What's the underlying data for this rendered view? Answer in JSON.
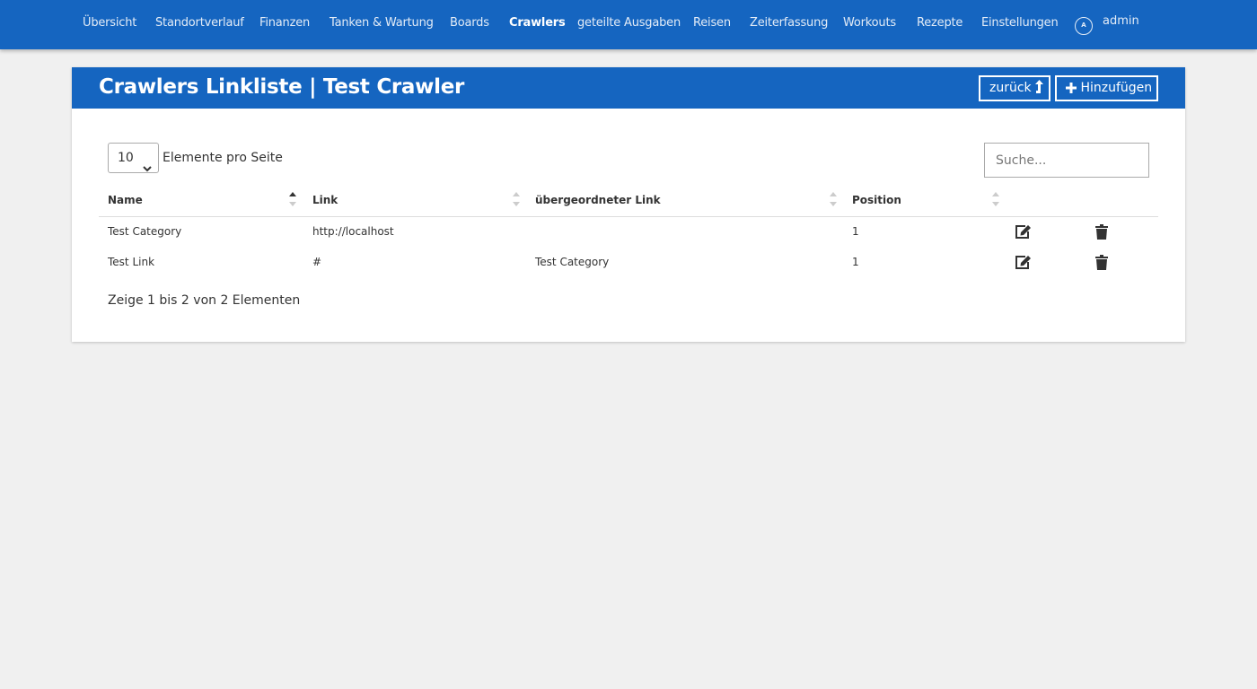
{
  "nav": {
    "items": [
      {
        "label": "Übersicht"
      },
      {
        "label": "Standortverlauf"
      },
      {
        "label": "Finanzen"
      },
      {
        "label": "Tanken & Wartung"
      },
      {
        "label": "Boards"
      },
      {
        "label": "Crawlers"
      },
      {
        "label": "geteilte Ausgaben"
      },
      {
        "label": "Reisen"
      },
      {
        "label": "Zeiterfassung"
      },
      {
        "label": "Workouts"
      },
      {
        "label": "Rezepte"
      },
      {
        "label": "Einstellungen"
      }
    ],
    "active": "Crawlers",
    "user": {
      "initial": "A",
      "name": "admin"
    }
  },
  "page": {
    "title": "Crawlers Linkliste | Test Crawler",
    "back_label": "zurück",
    "add_label": "Hinzufügen"
  },
  "table": {
    "length_value": "10",
    "length_label": "Elemente pro Seite",
    "search_placeholder": "Suche...",
    "columns": [
      "Name",
      "Link",
      "übergeordneter Link",
      "Position"
    ],
    "sorted_column": "Name",
    "rows": [
      {
        "name": "Test Category",
        "link": "http://localhost",
        "parent": "",
        "position": "1"
      },
      {
        "name": "Test Link",
        "link": "#",
        "parent": "Test Category",
        "position": "1"
      }
    ],
    "info": "Zeige 1 bis 2 von 2 Elementen"
  },
  "colors": {
    "primary": "#1565c0",
    "background": "#f0f0f0"
  },
  "icons": {
    "user": "user-circle-icon",
    "back": "arrow-up-icon",
    "add": "plus-icon",
    "edit": "edit-icon",
    "delete": "trash-icon",
    "select": "chevron-down-icon"
  }
}
